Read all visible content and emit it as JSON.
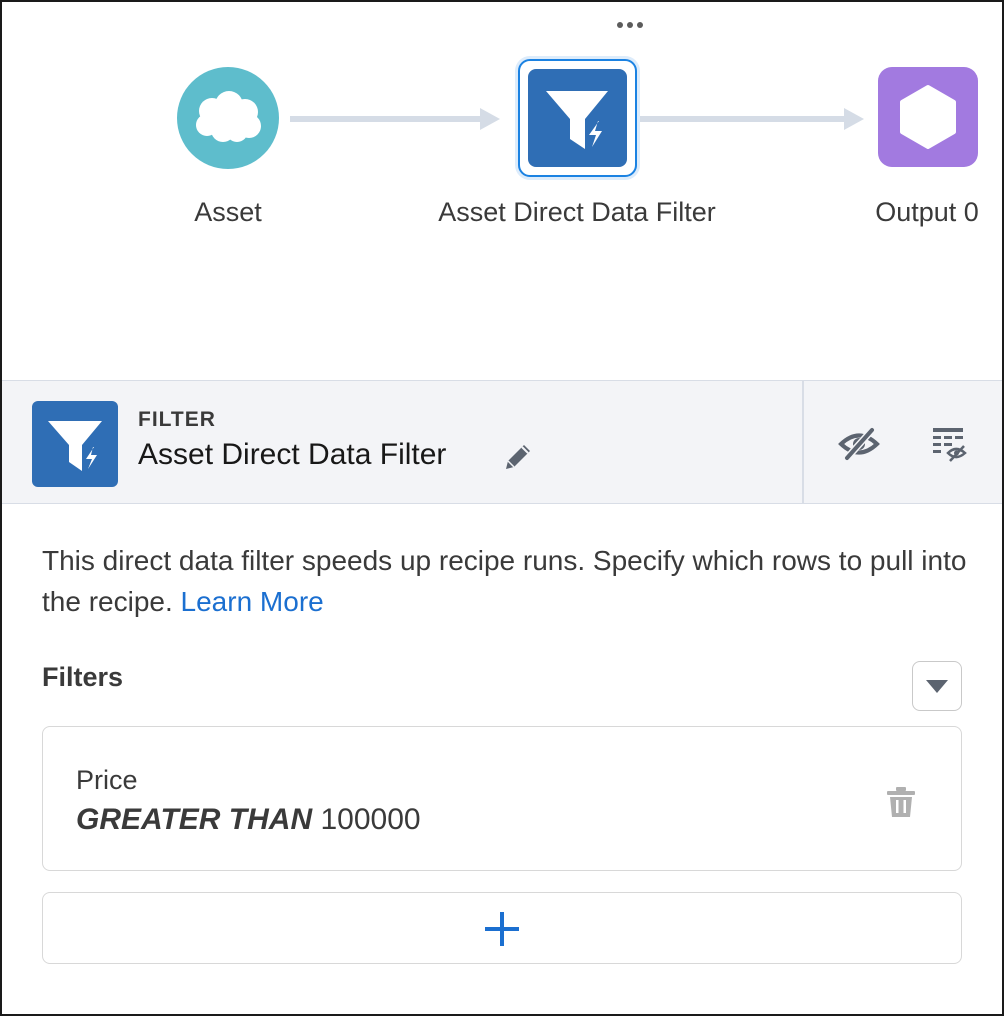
{
  "canvas": {
    "nodes": [
      {
        "label": "Asset",
        "icon": "salesforce-cloud-icon",
        "color": "#5ebdcc"
      },
      {
        "label": "Asset Direct Data Filter",
        "icon": "filter-icon",
        "color": "#2f6eb5"
      },
      {
        "label": "Output 0",
        "icon": "hexagon-icon",
        "color": "#a27ae0"
      }
    ],
    "selected_node": "Asset Direct Data Filter"
  },
  "panel": {
    "type_label": "FILTER",
    "title": "Asset Direct Data Filter",
    "description": "This direct data filter speeds up recipe runs. Specify which rows to pull into the recipe.",
    "learn_more": "Learn More",
    "filters_heading": "Filters",
    "filters": [
      {
        "field": "Price",
        "operator": "GREATER THAN",
        "value": "100000"
      }
    ]
  },
  "colors": {
    "accent": "#1b6fd0",
    "selection_border": "#1b82e2",
    "header_bg": "#f3f4f7"
  }
}
